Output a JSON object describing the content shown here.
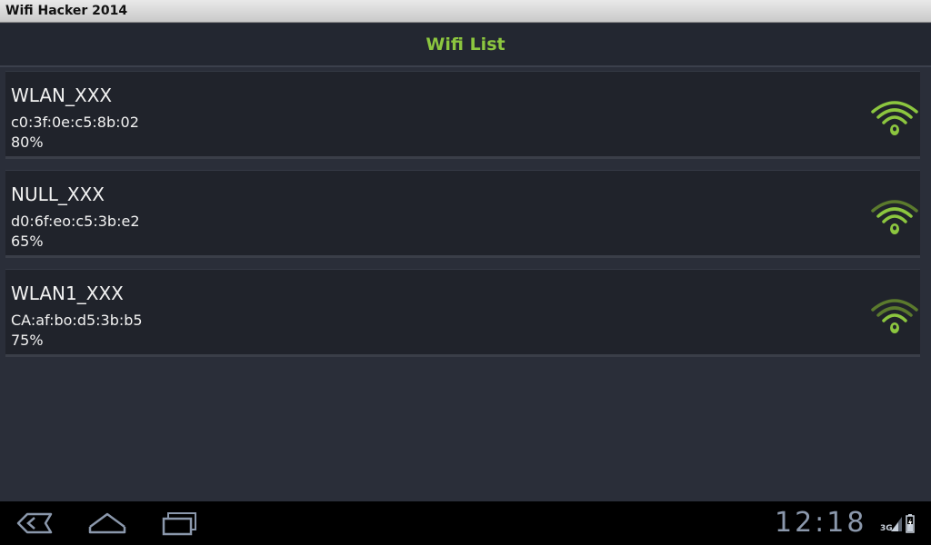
{
  "window": {
    "title": "Wifi Hacker 2014"
  },
  "header": {
    "title": "Wifi List"
  },
  "networks": [
    {
      "ssid": "WLAN_XXX",
      "mac": "c0:3f:0e:c5:8b:02",
      "strength": "80%"
    },
    {
      "ssid": "NULL_XXX",
      "mac": "d0:6f:eo:c5:3b:e2",
      "strength": "65%"
    },
    {
      "ssid": "WLAN1_XXX",
      "mac": "CA:af:bo:d5:3b:b5",
      "strength": "75%"
    }
  ],
  "statusbar": {
    "time": "12:18",
    "network_type": "3G"
  },
  "icons": {
    "wifi": "wifi-signal-icon",
    "back": "back-icon",
    "home": "home-icon",
    "recent": "recent-apps-icon",
    "signal": "cell-signal-icon",
    "battery": "battery-charging-icon"
  },
  "colors": {
    "accent": "#8cc63f",
    "background": "#2a2e39",
    "item_background": "#20232b",
    "nav_icon": "#8b98ac"
  }
}
